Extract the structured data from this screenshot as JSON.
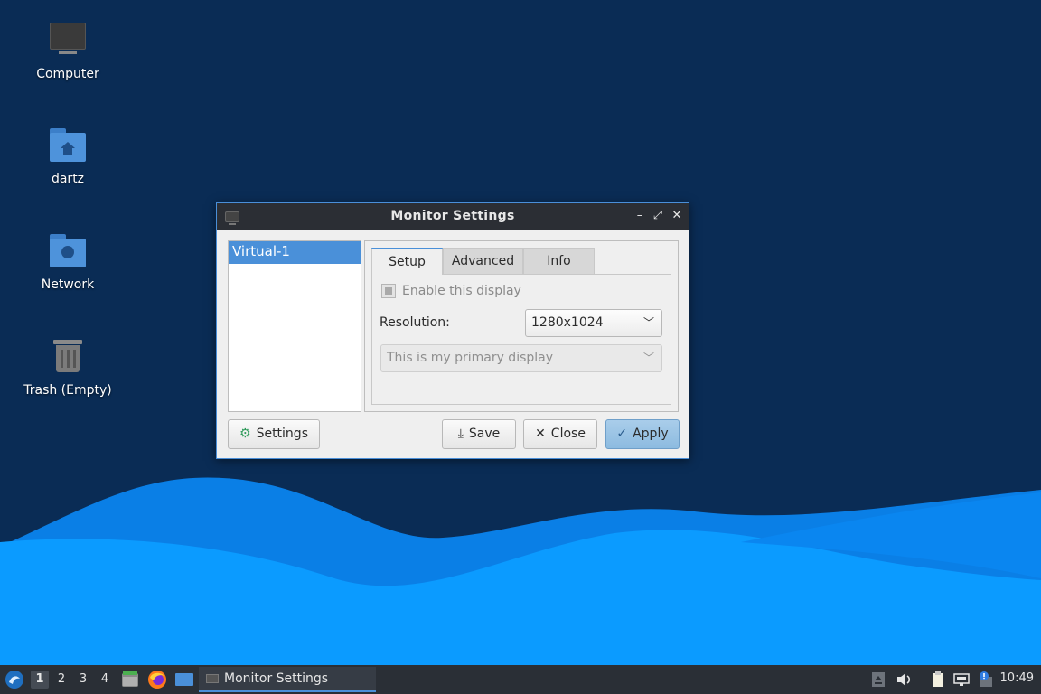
{
  "desktop": {
    "icons": [
      {
        "label": "Computer"
      },
      {
        "label": "dartz"
      },
      {
        "label": "Network"
      },
      {
        "label": "Trash (Empty)"
      }
    ]
  },
  "window": {
    "title": "Monitor Settings",
    "displays": [
      "Virtual-1"
    ],
    "tabs": [
      "Setup",
      "Advanced",
      "Info"
    ],
    "setup": {
      "enable_label": "Enable this display",
      "resolution_label": "Resolution:",
      "resolution_value": "1280x1024",
      "primary_value": "This is my primary display"
    },
    "buttons": {
      "settings": "Settings",
      "save": "Save",
      "close": "Close",
      "apply": "Apply"
    }
  },
  "taskbar": {
    "workspaces": [
      "1",
      "2",
      "3",
      "4"
    ],
    "task_title": "Monitor Settings",
    "clock": "10:49"
  },
  "colors": {
    "accent": "#4a90d9",
    "desktop_bg": "#0a2c55",
    "wave_light": "#0a9bff",
    "wave_dark": "#0572d8"
  }
}
